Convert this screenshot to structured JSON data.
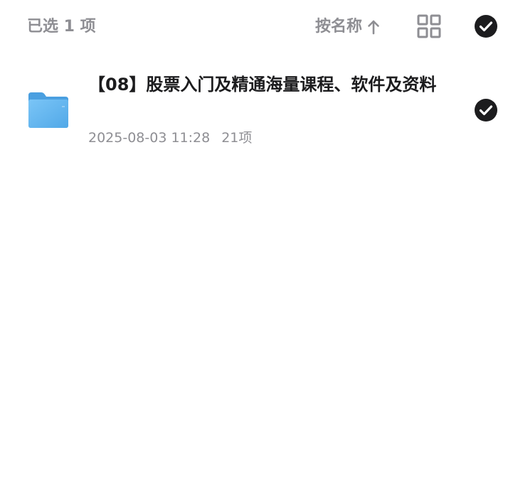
{
  "header": {
    "selected_label": "已选 1 项",
    "sort_label": "按名称",
    "sort_icon": "arrow-up-icon",
    "view_icon": "grid-view-icon",
    "select_all_icon": "check-circle-icon"
  },
  "files": [
    {
      "name": "【08】股票入门及精通海量课程、软件及资料",
      "date": "2025-08-03 11:28",
      "count": "21项",
      "icon": "folder-icon",
      "selected": true
    }
  ],
  "colors": {
    "muted_text": "#8e8e93",
    "primary_text": "#1c1c1e",
    "check_fill": "#1c1c1e",
    "folder_blue": "#5fb3f0"
  }
}
